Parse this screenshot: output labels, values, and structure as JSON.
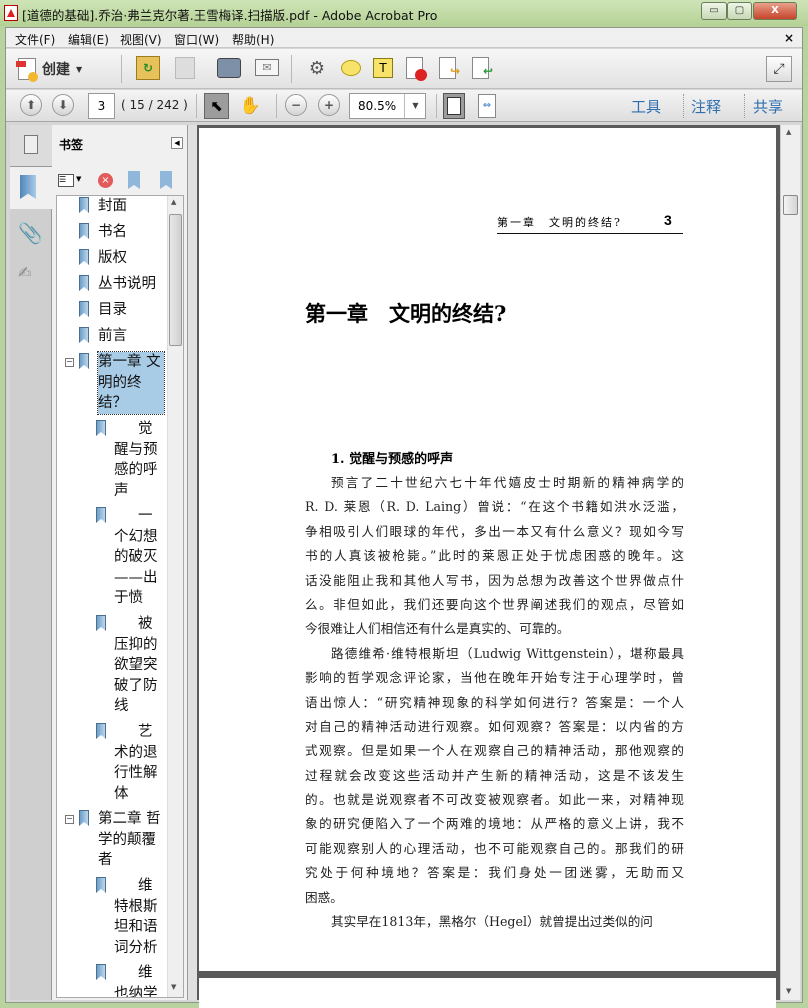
{
  "window": {
    "title": "[道德的基础].乔治·弗兰克尔著.王雪梅译.扫描版.pdf - Adobe Acrobat Pro",
    "min": "▭",
    "max": "▢",
    "close": "X"
  },
  "menu": [
    "文件(F)",
    "编辑(E)",
    "视图(V)",
    "窗口(W)",
    "帮助(H)"
  ],
  "menu_close": "×",
  "toolbar": {
    "create_label": "创建",
    "page_input": "3",
    "page_count": "( 15 / 242 )",
    "zoom": "80.5%",
    "tools": "工具",
    "comment": "注释",
    "share": "共享"
  },
  "bookmarks_panel": {
    "title": "书签",
    "items": [
      {
        "label": "封面",
        "level": 0
      },
      {
        "label": "书名",
        "level": 0
      },
      {
        "label": "版权",
        "level": 0
      },
      {
        "label": "丛书说明",
        "level": 0
      },
      {
        "label": "目录",
        "level": 0
      },
      {
        "label": "前言",
        "level": 0
      },
      {
        "label": "第一章 文明的终结？",
        "level": 0,
        "expanded": true,
        "selected": true
      },
      {
        "label": "觉醒与预感的呼声",
        "level": 1
      },
      {
        "label": "一个幻想的破灭——出于愤",
        "level": 1
      },
      {
        "label": "被压抑的欲望突破了防线",
        "level": 1
      },
      {
        "label": "艺术的退行性解体",
        "level": 1
      },
      {
        "label": "第二章 哲学的颠覆者",
        "level": 0,
        "expanded": true
      },
      {
        "label": "维特根斯坦和语词分析",
        "level": 1
      },
      {
        "label": "维也纳学",
        "level": 1
      }
    ]
  },
  "document": {
    "running_head": "第一章　文明的终结?",
    "page_number": "3",
    "chapter_title": "第一章　文明的终结?",
    "section_title": "1. 觉醒与预感的呼声",
    "lines": [
      {
        "t": "预言了二十世纪六七十年代嬉皮士时期新的精神病学的",
        "ind": true
      },
      {
        "t": "R. D. 莱恩（R. D. Laing）曾说：“在这个书籍如洪水泛滥，"
      },
      {
        "t": "争相吸引人们眼球的年代，多出一本又有什么意义？现如今写"
      },
      {
        "t": "书的人真该被枪毙。”此时的莱恩正处于忧虑困惑的晚年。这"
      },
      {
        "t": "话没能阻止我和其他人写书，因为总想为改善这个世界做点什"
      },
      {
        "t": "么。非但如此，我们还要向这个世界阐述我们的观点，尽管如"
      },
      {
        "t": "今很难让人们相信还有什么是真实的、可靠的。",
        "last": true
      },
      {
        "t": "路德维希·维特根斯坦（Ludwig Wittgenstein），堪称最具",
        "ind": true
      },
      {
        "t": "影响的哲学观念评论家，当他在晚年开始专注于心理学时，曾"
      },
      {
        "t": "语出惊人：“研究精神现象的科学如何进行？答案是：一个人"
      },
      {
        "t": "对自己的精神活动进行观察。如何观察？答案是：以内省的方"
      },
      {
        "t": "式观察。但是如果一个人在观察自己的精神活动，那他观察的"
      },
      {
        "t": "过程就会改变这些活动并产生新的精神活动，这是不该发生"
      },
      {
        "t": "的。也就是说观察者不可改变被观察者。如此一来，对精神现"
      },
      {
        "t": "象的研究便陷入了一个两难的境地：从严格的意义上讲，我不"
      },
      {
        "t": "可能观察别人的心理活动，也不可能观察自己的。那我们的研"
      },
      {
        "t": "究处于何种境地？答案是：我们身处一团迷雾，无助而又"
      },
      {
        "t": "困惑。",
        "last": true
      },
      {
        "t": "其实早在1813年，黑格尔（Hegel）就曾提出过类似的问",
        "ind": true
      }
    ]
  }
}
